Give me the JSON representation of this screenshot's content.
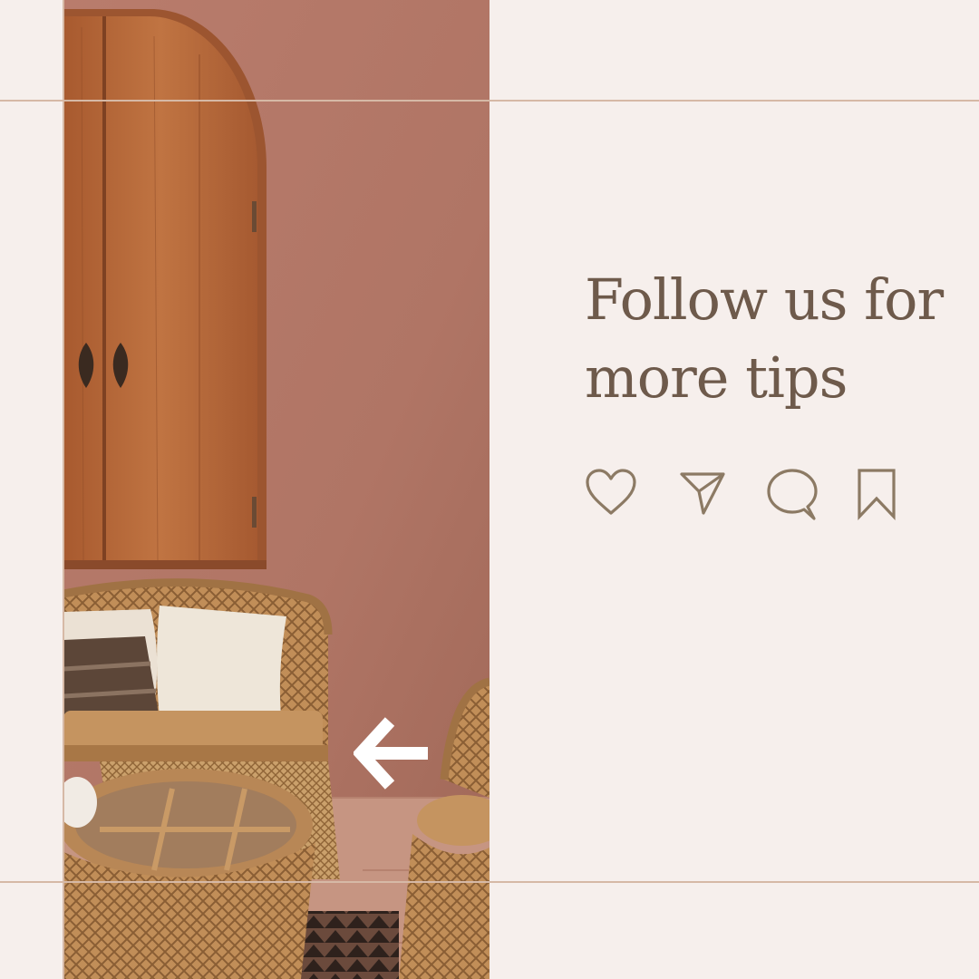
{
  "headline": "Follow us for more tips",
  "icons": {
    "like": "heart-icon",
    "share": "send-icon",
    "comment": "comment-icon",
    "save": "bookmark-icon",
    "navigate": "arrow-left-icon"
  },
  "colors": {
    "background": "#f6efec",
    "text": "#6e5a4b",
    "icon_stroke": "#8c7a64",
    "guide_line": "#d6b9a6",
    "wall": "#b5796a",
    "wood": "#b9693a",
    "rattan": "#c6955f",
    "arrow": "#ffffff"
  }
}
